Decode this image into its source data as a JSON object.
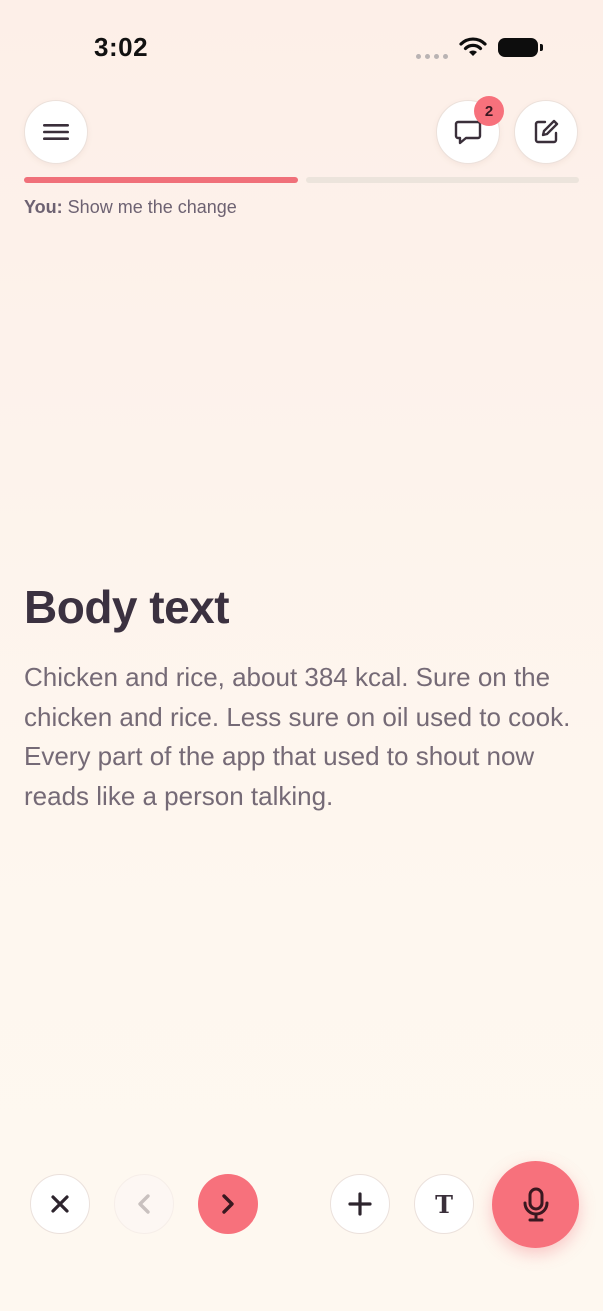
{
  "status_bar": {
    "time": "3:02",
    "wifi_icon": "wifi-icon",
    "battery_icon": "battery-icon"
  },
  "header": {
    "menu_icon": "menu-icon",
    "chat_icon": "chat-bubble-icon",
    "chat_badge": "2",
    "edit_icon": "compose-icon"
  },
  "progress": {
    "segments_total": 2,
    "segments_done": 1,
    "done_color": "#f0707a",
    "todo_color": "#ece4dc"
  },
  "transcript": {
    "speaker": "You:",
    "text": "Show me the change"
  },
  "card": {
    "title": "Body text",
    "body": "Chicken and rice, about 384 kcal. Sure on the chicken and rice. Less sure on oil used to cook. Every part of the app that used to shout now reads like a person talking."
  },
  "controls": {
    "close_icon": "close-icon",
    "prev_icon": "chevron-left-icon",
    "next_icon": "chevron-right-icon",
    "add_icon": "plus-icon",
    "text_label": "T",
    "mic_icon": "microphone-icon",
    "accent_color": "#f7717c"
  }
}
